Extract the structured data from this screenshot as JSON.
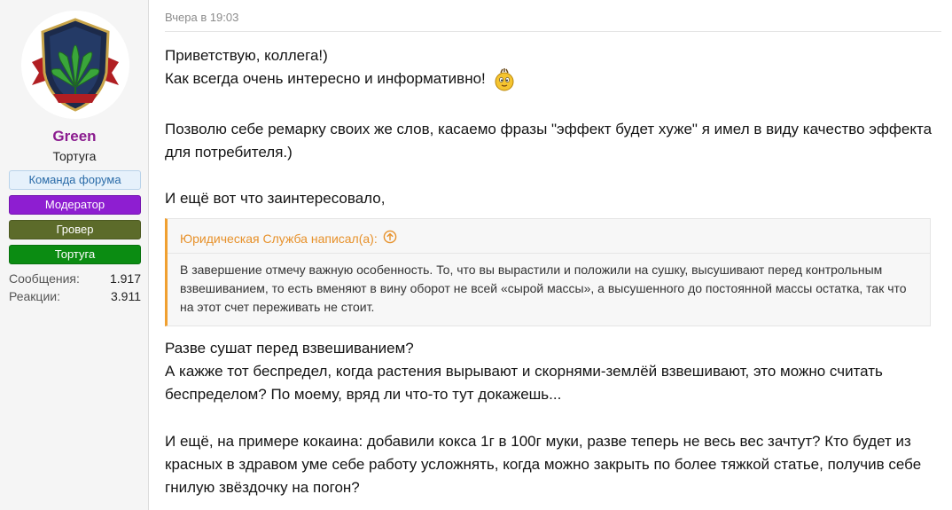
{
  "user": {
    "name": "Green",
    "title": "Тортуга",
    "banners": [
      "Команда форума",
      "Модератор",
      "Гровер",
      "Тортуга"
    ],
    "stats": [
      {
        "label": "Сообщения:",
        "value": "1.917"
      },
      {
        "label": "Реакции:",
        "value": "3.911"
      }
    ]
  },
  "post": {
    "date": "Вчера в 19:03",
    "p1_line1": "Приветствую, коллега!)",
    "p1_line2": "Как всегда очень интересно и информативно!",
    "p2": "Позволю себе ремарку своих же слов, касаемо фразы \"эффект будет хуже\" я имел в виду качество эффекта для потребителя.)",
    "p3": "И ещё вот что заинтересовало,",
    "quote": {
      "author": "Юридическая Служба написал(а):",
      "text": "В завершение отмечу важную особенность. То, что вы вырастили и положили на сушку, высушивают перед контрольным взвешиванием, то есть вменяют в вину оборот не всей «сырой массы», а высушенного до постоянной массы остатка, так что на этот счет переживать не стоит."
    },
    "p4_line1": "Разве сушат перед взвешиванием?",
    "p4_line2": "А кажже тот беспредел, когда растения вырывают и скорнями-землёй взвешивают, это можно считать беспределом? По моему, вряд ли что-то тут докажешь...",
    "p5": "И ещё, на примере кокаина: добавили кокса 1г в 100г муки, разве теперь не весь вес зачтут? Кто будет из красных в здравом уме себе работу усложнять, когда можно закрыть по более тяжкой статье, получив себе гнилую звёздочку на погон?"
  },
  "colors": {
    "username": "#8b1c8f",
    "moderator": "#8e1ed1",
    "grower": "#5c6b2a",
    "tortuga": "#0b8c12",
    "quote_accent": "#f0a030"
  },
  "icons": {
    "avatar": "cannabis-leaf-shield-logo",
    "emoji": "shy-smiley-icon",
    "quote_jump": "arrow-up-circle-icon"
  }
}
